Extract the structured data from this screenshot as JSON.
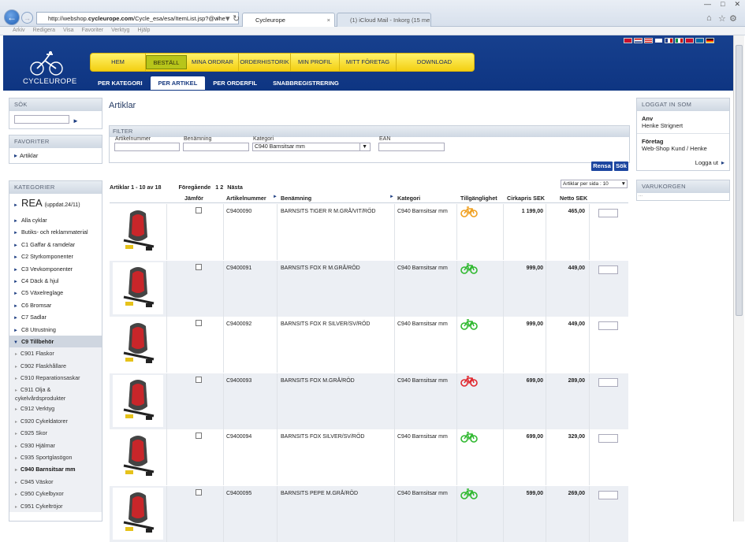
{
  "browser": {
    "url_prefix": "http://webshop.",
    "url_bold": "cycleurope.com",
    "url_rest": "/Cycle_esa/esa/ItemList.jsp?@whe",
    "tab1": "Cycleurope",
    "tab2": "(1) iCloud Mail - Inkorg (15 me..."
  },
  "menubar": [
    "Arkiv",
    "Redigera",
    "Visa",
    "Favoriter",
    "Verktyg",
    "Hjälp"
  ],
  "logo": "CYCLEUROPE",
  "main_nav": [
    "HEM",
    "BESTÄLL",
    "MINA ORDRAR",
    "ORDERHISTORIK",
    "MIN PROFIL",
    "MITT FÖRETAG",
    "DOWNLOAD"
  ],
  "sub_nav": [
    "PER KATEGORI",
    "PER ARTIKEL",
    "PER ORDERFIL",
    "SNABBREGISTRERING"
  ],
  "left": {
    "sok_title": "SÖK",
    "favoriter_title": "FAVORITER",
    "fav_item": "Artiklar",
    "kategorier_title": "KATEGORIER",
    "rea": "REA",
    "rea_note": "(uppdat.24/11)",
    "cats": [
      "Alla cyklar",
      "Butiks- och reklammaterial",
      "C1 Gaffar & ramdelar",
      "C2 Styrkomponenter",
      "C3 Vevkomponenter",
      "C4 Däck & hjul",
      "C5 Växelreglage",
      "C6 Bromsar",
      "C7 Sadlar",
      "C8 Utrustning"
    ],
    "open_cat": "C9 Tillbehör",
    "subcats": [
      "C901 Flaskor",
      "C902 Flaskhållare",
      "C910 Reparationsaskar",
      "C911 Olja & cykelvårdsprodukter",
      "C912 Verktyg",
      "C920 Cykeldatorer",
      "C925 Skor",
      "C930 Hjälmar",
      "C935 Sportglasögon",
      "C940 Barnsitsar mm",
      "C945 Väskor",
      "C950 Cykelbyxor",
      "C951 Cykeltröjor"
    ]
  },
  "main": {
    "title": "Artiklar",
    "filter_title": "FILTER",
    "f_artnr": "Artikelnummer",
    "f_ben": "Benämning",
    "f_kat": "Kategori",
    "f_kat_value": "C940 Barnsitsar mm",
    "f_ean": "EAN",
    "btn_rensa": "Rensa",
    "btn_sok": "Sök",
    "range": "Artiklar 1 - 10 av 18",
    "prev": "Föregående",
    "pages": "1  2",
    "next": "Nästa",
    "per_page": "Artiklar per sida : 10",
    "headers": {
      "jamfor": "Jämför",
      "artnr": "Artikelnummer",
      "ben": "Benämning",
      "kat": "Kategori",
      "tillg": "Tillgänglighet",
      "cirka": "Cirkapris SEK",
      "netto": "Netto SEK"
    },
    "rows": [
      {
        "artnr": "C9400090",
        "ben": "BARNSITS TIGER R M.GRÅ/VIT/RÖD",
        "kat": "C940 Barnsitsar mm",
        "cirka": "1 199,00",
        "netto": "465,00",
        "avail_color": "#f0a020"
      },
      {
        "artnr": "C9400091",
        "ben": "BARNSITS FOX R M.GRÅ/RÖD",
        "kat": "C940 Barnsitsar mm",
        "cirka": "999,00",
        "netto": "449,00",
        "avail_color": "#2fb82f"
      },
      {
        "artnr": "C9400092",
        "ben": "BARNSITS FOX R SILVER/SV/RÖD",
        "kat": "C940 Barnsitsar mm",
        "cirka": "999,00",
        "netto": "449,00",
        "avail_color": "#2fb82f"
      },
      {
        "artnr": "C9400093",
        "ben": "BARNSITS FOX M.GRÅ/RÖD",
        "kat": "C940 Barnsitsar mm",
        "cirka": "699,00",
        "netto": "289,00",
        "avail_color": "#e0262c"
      },
      {
        "artnr": "C9400094",
        "ben": "BARNSITS FOX SILVER/SV/RÖD",
        "kat": "C940 Barnsitsar mm",
        "cirka": "699,00",
        "netto": "329,00",
        "avail_color": "#2fb82f"
      },
      {
        "artnr": "C9400095",
        "ben": "BARNSITS PEPE M.GRÅ/RÖD",
        "kat": "C940 Barnsitsar mm",
        "cirka": "599,00",
        "netto": "269,00",
        "avail_color": "#2fb82f"
      }
    ]
  },
  "right": {
    "logged_title": "LOGGAT IN SOM",
    "anv_label": "Anv",
    "anv_value": "Henke Strignert",
    "foretag_label": "Företag",
    "foretag_value": "Web-Shop Kund / Henke",
    "logout": "Logga ut",
    "cart_title": "VARUKORGEN",
    "cart_dots": "..."
  }
}
